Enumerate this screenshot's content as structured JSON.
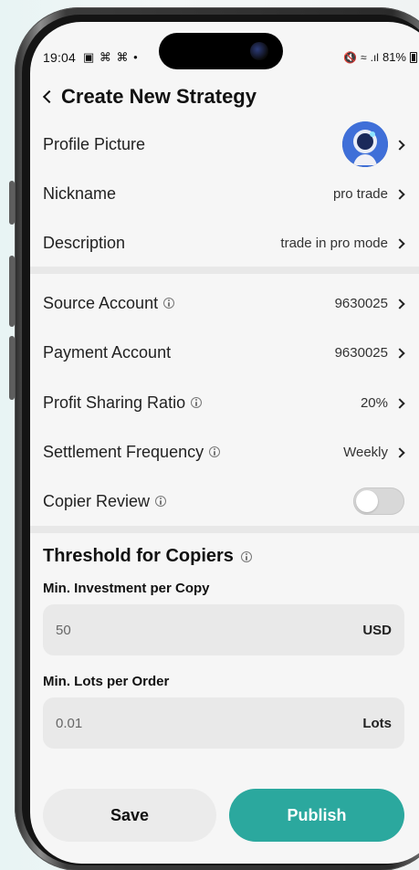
{
  "status_bar": {
    "time": "19:04",
    "left_icons": "▣ ⌘ ⌘ •",
    "mute": "🔇",
    "wifi": "≈",
    "signal": ".ıl",
    "battery": "81%"
  },
  "header": {
    "title": "Create New Strategy"
  },
  "profile": {
    "profile_picture_label": "Profile Picture",
    "nickname_label": "Nickname",
    "nickname_value": "pro trade",
    "description_label": "Description",
    "description_value": "trade in pro mode"
  },
  "settings": {
    "source_account_label": "Source Account",
    "source_account_value": "9630025",
    "payment_account_label": "Payment Account",
    "payment_account_value": "9630025",
    "profit_sharing_ratio_label": "Profit Sharing Ratio",
    "profit_sharing_ratio_value": "20%",
    "settlement_frequency_label": "Settlement Frequency",
    "settlement_frequency_value": "Weekly",
    "copier_review_label": "Copier Review"
  },
  "threshold": {
    "title": "Threshold for Copiers",
    "min_investment_label": "Min. Investment per Copy",
    "min_investment_value": "50",
    "min_investment_unit": "USD",
    "min_lots_label": "Min. Lots per Order",
    "min_lots_value": "0.01",
    "min_lots_unit": "Lots"
  },
  "actions": {
    "save_label": "Save",
    "publish_label": "Publish"
  }
}
